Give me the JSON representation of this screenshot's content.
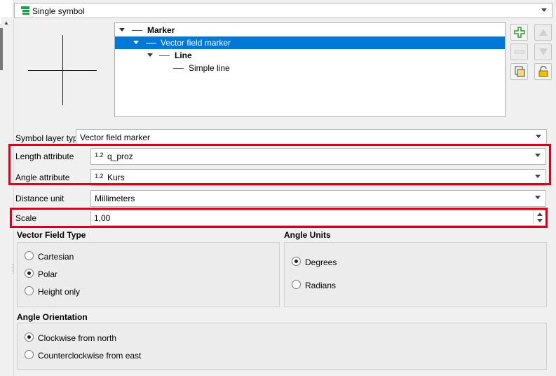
{
  "renderer": {
    "label": "Single symbol",
    "icon": "single-symbol-icon"
  },
  "tree": {
    "items": [
      {
        "label": "Marker",
        "bold": true,
        "selected": false
      },
      {
        "label": "Vector field marker",
        "bold": false,
        "selected": true
      },
      {
        "label": "Line",
        "bold": true,
        "selected": false
      },
      {
        "label": "Simple line",
        "bold": false,
        "selected": false
      }
    ]
  },
  "tools": {
    "add": "plus-icon",
    "up": "arrow-up-icon",
    "remove": "minus-icon",
    "down": "arrow-down-icon",
    "duplicate": "duplicate-icon",
    "lock": "lock-icon"
  },
  "form": {
    "symbol_layer_type_label": "Symbol layer type",
    "symbol_layer_type_value": "Vector field marker",
    "length_label": "Length attribute",
    "length_badge": "1.2",
    "length_value": "q_proz",
    "angle_label": "Angle attribute",
    "angle_badge": "1.2",
    "angle_value": "Kurs",
    "distance_unit_label": "Distance unit",
    "distance_unit_value": "Millimeters",
    "scale_label": "Scale",
    "scale_value": "1,00"
  },
  "vector_field_type": {
    "title": "Vector Field Type",
    "options": [
      {
        "label": "Cartesian",
        "checked": false
      },
      {
        "label": "Polar",
        "checked": true
      },
      {
        "label": "Height only",
        "checked": false
      }
    ]
  },
  "angle_units": {
    "title": "Angle Units",
    "options": [
      {
        "label": "Degrees",
        "checked": true
      },
      {
        "label": "Radians",
        "checked": false
      }
    ]
  },
  "angle_orientation": {
    "title": "Angle Orientation",
    "options": [
      {
        "label": "Clockwise from north",
        "checked": true
      },
      {
        "label": "Counterclockwise from east",
        "checked": false
      }
    ]
  },
  "colors": {
    "highlight": "#d9001b",
    "selection": "#0078d7",
    "add_green": "#2a9d2a"
  }
}
